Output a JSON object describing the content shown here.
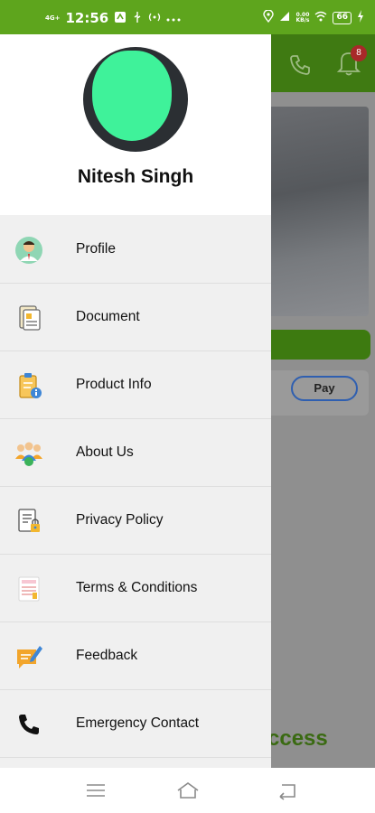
{
  "status_bar": {
    "network": "4G+",
    "time": "12:56",
    "speed_value": "0.00",
    "speed_unit": "KB/s",
    "battery": "66"
  },
  "background": {
    "badge_count": "8",
    "pay_label": "Pay",
    "success_text": "ccess"
  },
  "drawer": {
    "user_name": "Nitesh Singh",
    "items": [
      {
        "label": "Profile",
        "icon": "profile-icon"
      },
      {
        "label": "Document",
        "icon": "document-icon"
      },
      {
        "label": "Product Info",
        "icon": "product-info-icon"
      },
      {
        "label": "About Us",
        "icon": "about-us-icon"
      },
      {
        "label": "Privacy Policy",
        "icon": "privacy-policy-icon"
      },
      {
        "label": "Terms & Conditions",
        "icon": "terms-icon"
      },
      {
        "label": "Feedback",
        "icon": "feedback-icon"
      },
      {
        "label": "Emergency Contact",
        "icon": "phone-icon"
      }
    ]
  },
  "colors": {
    "brand_green": "#5ea51d",
    "drawer_bg": "#f0f0f0"
  }
}
